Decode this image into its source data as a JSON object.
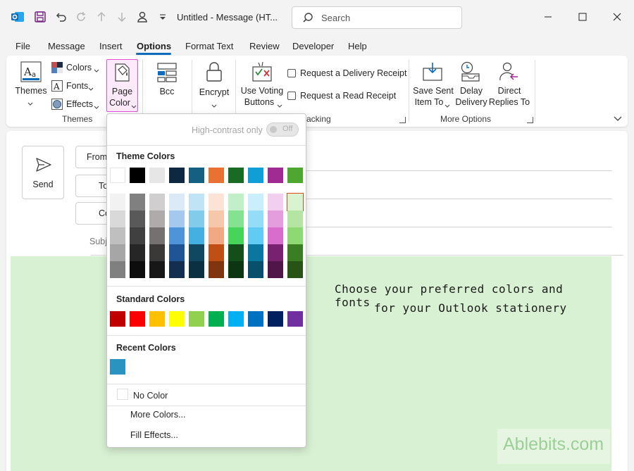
{
  "titlebar": {
    "title": "Untitled  -  Message (HT...",
    "search_placeholder": "Search"
  },
  "tabs": [
    "File",
    "Message",
    "Insert",
    "Options",
    "Format Text",
    "Review",
    "Developer",
    "Help"
  ],
  "ribbon": {
    "themes_label": "Themes",
    "colors_label": "Colors",
    "fonts_label": "Fonts",
    "effects_label": "Effects",
    "page_label": "Page",
    "color_label": "Color",
    "themes_group": "Themes",
    "bcc_label": "Bcc",
    "encrypt_label": "Encrypt",
    "use_voting_label": "Use Voting",
    "buttons_label": "Buttons",
    "delivery_receipt_label": "Request a Delivery Receipt",
    "read_receipt_label": "Request a Read Receipt",
    "tracking_group": "acking",
    "save_sent_label": "Save Sent",
    "item_to_label": "Item To",
    "delay_label": "Delay",
    "delivery_label": "Delivery",
    "direct_label": "Direct",
    "replies_to_label": "Replies To",
    "more_options_group": "More Options"
  },
  "compose": {
    "send_label": "Send",
    "from_label": "From",
    "to_label": "To",
    "cc_label": "Cc",
    "subject_label": "Subj",
    "body_line1": "Choose your preferred colors and fonts",
    "body_line2": "for your Outlook stationery",
    "watermark": "Ablebits.com"
  },
  "dropdown": {
    "high_contrast_label": "High-contrast only",
    "toggle_state": "Off",
    "theme_colors_title": "Theme Colors",
    "standard_colors_title": "Standard Colors",
    "recent_colors_title": "Recent Colors",
    "no_color_label": "No Color",
    "more_colors_label": "More Colors...",
    "fill_effects_label": "Fill Effects...",
    "theme_top": [
      "#ffffff",
      "#000000",
      "#e7e6e6",
      "#0e2841",
      "#156082",
      "#e97132",
      "#196b24",
      "#0f9ed5",
      "#a02b93",
      "#4ea72e"
    ],
    "theme_shades": [
      [
        "#f2f2f2",
        "#d9d9d9",
        "#bfbfbf",
        "#a6a6a6",
        "#808080"
      ],
      [
        "#808080",
        "#595959",
        "#404040",
        "#262626",
        "#0d0d0d"
      ],
      [
        "#d0cece",
        "#afabab",
        "#767171",
        "#3b3838",
        "#181717"
      ],
      [
        "#dceaf7",
        "#a5c8ee",
        "#4e94d8",
        "#1f5597",
        "#142e4f"
      ],
      [
        "#c0e4f5",
        "#83cbeb",
        "#44b0e1",
        "#104862",
        "#0b3041"
      ],
      [
        "#fbe3d6",
        "#f7c7ac",
        "#f1a983",
        "#c04f15",
        "#803510"
      ],
      [
        "#c1f0c8",
        "#84e291",
        "#47d45a",
        "#124f1a",
        "#0c3511"
      ],
      [
        "#caeefb",
        "#94dcf8",
        "#61cbf4",
        "#0b769f",
        "#074f6a"
      ],
      [
        "#f2cfee",
        "#e49edd",
        "#d86dcd",
        "#782170",
        "#501549"
      ],
      [
        "#d9f2d0",
        "#b4e5a2",
        "#8ed973",
        "#3a7d22",
        "#275317"
      ]
    ],
    "standard": [
      "#c00000",
      "#ff0000",
      "#ffc000",
      "#ffff00",
      "#92d050",
      "#00b050",
      "#00b0f0",
      "#0070c0",
      "#002060",
      "#7030a0"
    ],
    "recent": [
      "#2a93bf"
    ]
  },
  "colors": {
    "accent": "#0f6cbd",
    "page_color_highlight": "#e64fe0",
    "body_background": "#d9f1d3"
  }
}
